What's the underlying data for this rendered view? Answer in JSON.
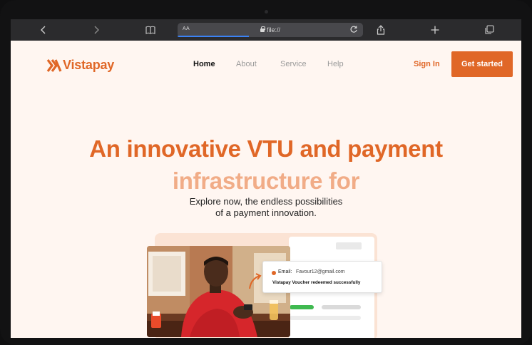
{
  "browser": {
    "reader_label": "AA",
    "url": "file://"
  },
  "site": {
    "brand": "Vistapay",
    "nav": [
      "Home",
      "About",
      "Service",
      "Help"
    ],
    "sign_in": "Sign In",
    "cta": "Get started"
  },
  "hero": {
    "line1": "An innovative VTU and payment",
    "line2": "infrastructure for",
    "sub_line1": "Explore now, the endless possibilities",
    "sub_line2": "of a payment innovation."
  },
  "notification": {
    "email_label": "Email:",
    "email_value": "Favour12@gmail.com",
    "message": "Vistapay Voucher redeemed successfully"
  },
  "colors": {
    "brand": "#e06727",
    "page_bg": "#fff6f1",
    "accent_green": "#3fb950"
  }
}
